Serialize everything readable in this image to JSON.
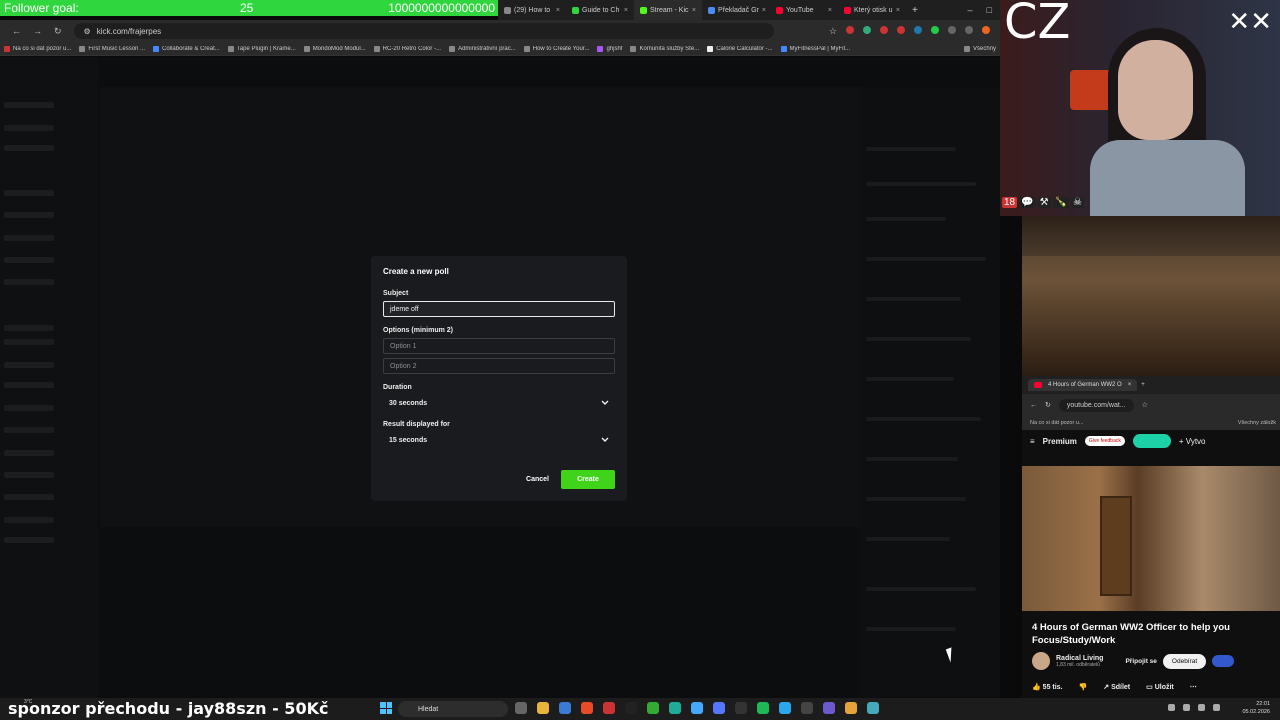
{
  "overlay": {
    "goal_label": "Follower goal:",
    "goal_current": "25",
    "goal_target": "1000000000000000",
    "sponsor_text": "sponzor přechodu - jay88szn - 50Kč",
    "cam_logo": "CZ",
    "cam_badge": "18"
  },
  "browser": {
    "tabs": [
      {
        "label": "(29) How to",
        "active": false
      },
      {
        "label": "Guide to Ch",
        "active": false
      },
      {
        "label": "Stream - Kic",
        "active": true
      },
      {
        "label": "Překladač Gr",
        "active": false
      },
      {
        "label": "YouTube",
        "active": false
      },
      {
        "label": "Který otisk u",
        "active": false
      }
    ],
    "url": "kick.com/frajerpes",
    "bookmarks": [
      "Na co si dát pozor u...",
      "First Music Lesson ...",
      "Collaborate & Creat...",
      "Tape Plugin | Krame...",
      "MondoMod Modul...",
      "RC-20 Retro Color -...",
      "Administrativní prac...",
      "How to Create Your...",
      "ghjshf",
      "Komunita služby Ste...",
      "Calorie Calculator -...",
      "MyFitnessPal | MyFit..."
    ],
    "bookmarks_all": "Všechny"
  },
  "poll_modal": {
    "title": "Create a new poll",
    "subject_label": "Subject",
    "subject_value": "jdeme off",
    "options_label": "Options (minimum 2)",
    "option1_placeholder": "Option 1",
    "option2_placeholder": "Option 2",
    "duration_label": "Duration",
    "duration_value": "30 seconds",
    "result_label": "Result displayed for",
    "result_value": "15 seconds",
    "cancel_label": "Cancel",
    "create_label": "Create"
  },
  "youtube": {
    "tab_title": "4 Hours of German WW2 O",
    "url": "youtube.com/wat...",
    "bookmark1": "Na co si dát pozor u...",
    "bookmarks_all": "Všechny záložk",
    "premium": "Premium",
    "feedback": "Give feedback",
    "create": "Vytvo",
    "video_title": "4 Hours of German WW2 Officer to help you Focus/Study/Work",
    "channel_name": "Radical Living",
    "subscribers": "1,83 mil. odběratelů",
    "join_label": "Připojit se",
    "subscribe_label": "Odebírat",
    "likes": "55 tis.",
    "share_label": "Sdílet",
    "save_label": "Uložit"
  },
  "taskbar": {
    "search_placeholder": "Hledat",
    "time": "22:01",
    "date": "05.02.2026",
    "weather": "3°C"
  },
  "colors": {
    "kick_green": "#53fc18",
    "goal_bar": "#2fd63d",
    "modal_bg": "#191b1f",
    "youtube_red": "#ff0033"
  }
}
